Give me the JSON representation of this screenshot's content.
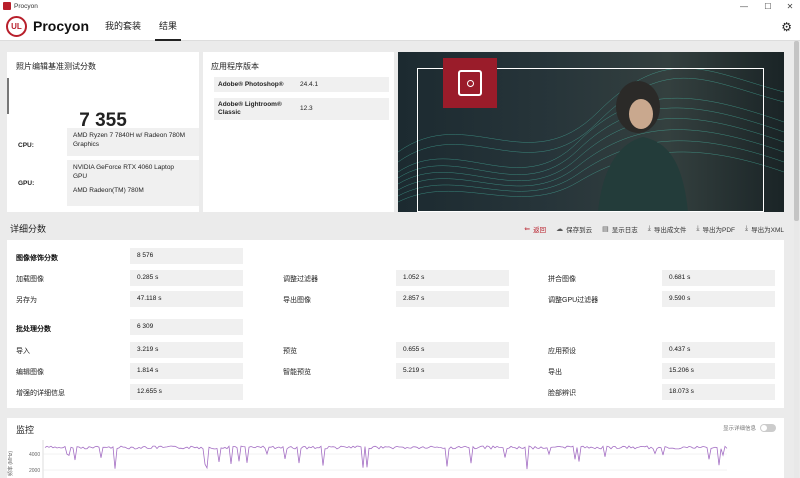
{
  "window": {
    "title": "Procyon",
    "minimize": "—",
    "maximize": "☐",
    "close": "✕"
  },
  "header": {
    "logo_text": "UL",
    "brand": "Procyon",
    "tabs": [
      {
        "label": "我的套装"
      },
      {
        "label": "结果"
      }
    ],
    "settings_icon": "gear-icon"
  },
  "score_card": {
    "title": "照片编辑基准测试分数",
    "score": "7 355",
    "cpu_label": "CPU:",
    "cpu_value": "AMD Ryzen 7 7840H w/ Radeon 780M Graphics",
    "gpu_label": "GPU:",
    "gpu_value_1": "NVIDIA GeForce RTX 4060 Laptop GPU",
    "gpu_value_2": "AMD Radeon(TM) 780M"
  },
  "version_card": {
    "title": "应用程序版本",
    "apps": [
      {
        "name": "Adobe® Photoshop®",
        "version": "24.4.1"
      },
      {
        "name": "Adobe® Lightroom® Classic",
        "version": "12.3"
      }
    ]
  },
  "details": {
    "title": "详细分数",
    "toolbar": {
      "back": "返回",
      "save_cloud": "保存到云",
      "show_log": "显示日志",
      "export_file": "导出成文件",
      "export_pdf": "导出为PDF",
      "export_xml": "导出为XML"
    },
    "photo_group": {
      "label": "图像修饰分数",
      "value": "8 576"
    },
    "photo_metrics": [
      {
        "label": "加载图像",
        "value": "0.285 s"
      },
      {
        "label": "调整过滤器",
        "value": "1.052 s"
      },
      {
        "label": "拼合图像",
        "value": "0.681 s"
      },
      {
        "label": "另存为",
        "value": "47.118 s"
      },
      {
        "label": "导出图像",
        "value": "2.857 s"
      },
      {
        "label": "调整GPU过滤器",
        "value": "9.590 s"
      }
    ],
    "batch_group": {
      "label": "批处理分数",
      "value": "6 309"
    },
    "batch_metrics": [
      {
        "label": "导入",
        "value": "3.219 s"
      },
      {
        "label": "预览",
        "value": "0.655 s"
      },
      {
        "label": "应用预设",
        "value": "0.437 s"
      },
      {
        "label": "编辑图像",
        "value": "1.814 s"
      },
      {
        "label": "智能预览",
        "value": "5.219 s"
      },
      {
        "label": "导出",
        "value": "15.206 s"
      },
      {
        "label": "增强的详细信息",
        "value": "12.655 s"
      },
      {
        "label": "",
        "value": ""
      },
      {
        "label": "脸部辨识",
        "value": "18.073 s"
      }
    ]
  },
  "monitor": {
    "title": "监控",
    "toggle_label": "显示详细信息",
    "y_axis_label": "频率 (MHz)",
    "ticks": [
      "4000",
      "2000"
    ],
    "line_color": "#a46fc4"
  },
  "colors": {
    "accent": "#b81f2b",
    "line": "#a46fc4"
  }
}
